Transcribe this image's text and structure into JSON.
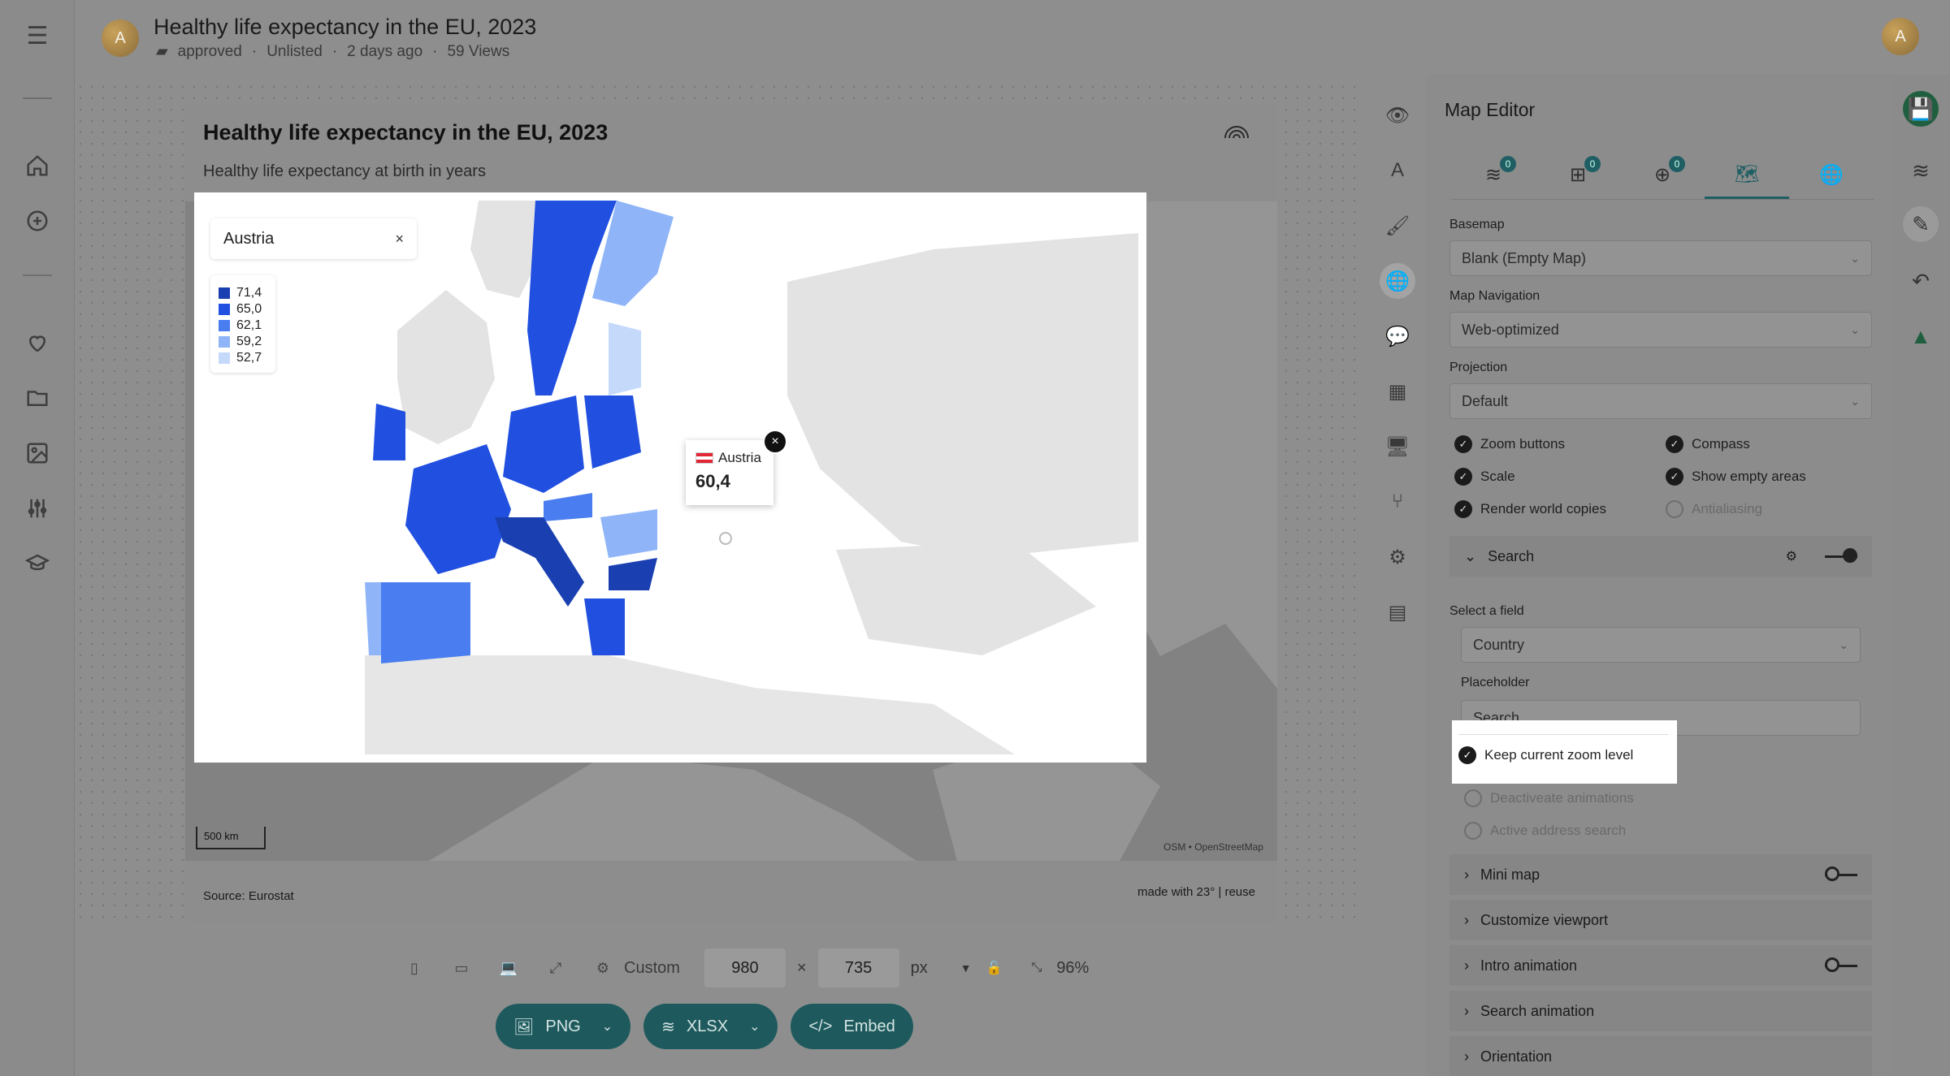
{
  "header": {
    "title": "Healthy life expectancy in the EU, 2023",
    "folder": "approved",
    "visibility": "Unlisted",
    "time": "2 days ago",
    "views": "59 Views",
    "avatar_initial": "A"
  },
  "chart": {
    "title": "Healthy life expectancy in the EU, 2023",
    "subtitle": "Healthy life expectancy at birth in years",
    "logo_text": "23°",
    "source": "Source: Eurostat",
    "made_with": "made with 23° | reuse",
    "attribution": "OSM • OpenStreetMap",
    "scale": "500 km"
  },
  "map": {
    "search_value": "Austria",
    "search_clear": "×",
    "zoom_in": "+",
    "zoom_out": "−",
    "compass": "▲",
    "legend": [
      {
        "label": "71,4",
        "color": "#1a3fb0"
      },
      {
        "label": "65,0",
        "color": "#2150e0"
      },
      {
        "label": "62,1",
        "color": "#4a7df0"
      },
      {
        "label": "59,2",
        "color": "#8fb5f8"
      },
      {
        "label": "52,7",
        "color": "#c5dafb"
      }
    ],
    "tooltip": {
      "country": "Austria",
      "value": "60,4",
      "close": "×"
    }
  },
  "bottom": {
    "preset": "Custom",
    "width": "980",
    "times": "×",
    "height": "735",
    "unit": "px",
    "zoom": "96%",
    "buttons": {
      "png": "PNG",
      "xlsx": "XLSX",
      "embed": "Embed"
    }
  },
  "panel": {
    "title": "Map Editor",
    "badges": [
      "0",
      "0",
      "0"
    ],
    "basemap_label": "Basemap",
    "basemap_value": "Blank (Empty Map)",
    "navigation_label": "Map Navigation",
    "navigation_value": "Web-optimized",
    "projection_label": "Projection",
    "projection_value": "Default",
    "checks": {
      "zoom_buttons": "Zoom buttons",
      "compass": "Compass",
      "scale": "Scale",
      "show_empty": "Show empty areas",
      "world_copies": "Render world copies",
      "antialiasing": "Antialiasing"
    },
    "search_section": "Search",
    "select_field_label": "Select a field",
    "select_field_value": "Country",
    "placeholder_label": "Placeholder",
    "placeholder_value": "Search",
    "keep_zoom": "Keep current zoom level",
    "deactivate_anim": "Deactiveate animations",
    "active_address": "Active address search",
    "sections": {
      "mini_map": "Mini map",
      "customize_viewport": "Customize viewport",
      "intro_animation": "Intro animation",
      "search_animation": "Search animation",
      "orientation": "Orientation"
    }
  }
}
